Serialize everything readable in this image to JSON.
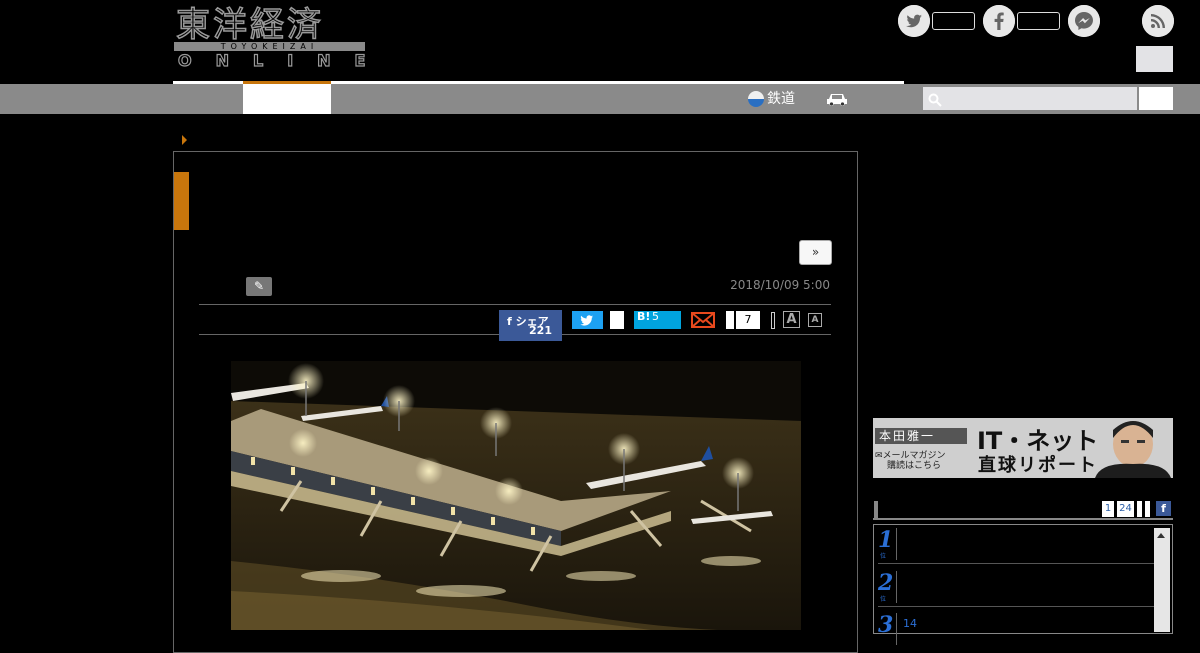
{
  "header": {
    "logo_jp": "東洋経済",
    "logo_band": "TOYOKEIZAI",
    "logo_en": "ONLINE",
    "social": [
      "twitter-icon",
      "facebook-icon",
      "messenger-icon",
      "rss-icon"
    ]
  },
  "nav": {
    "railway_label": "鉄道",
    "search_placeholder": ""
  },
  "article": {
    "next_label": "»",
    "date": "2018/10/09 5:00",
    "share": {
      "facebook_label": "シェア",
      "facebook_count": "221",
      "hatena_label": "B!",
      "hatena_count": "5",
      "comment_count": "7",
      "font_large": "A",
      "font_small": "A"
    }
  },
  "sidebar": {
    "banner": {
      "author": "本田雅一",
      "mail_line1": "メールマガジン",
      "mail_line2": "購読はこちら",
      "title1": "IT・ネット",
      "title2": "直球リポート"
    },
    "ranking": {
      "tabs": [
        "1",
        "24"
      ],
      "fb_label": "f",
      "ranks": [
        {
          "num": "1",
          "text": ""
        },
        {
          "num": "2",
          "text": ""
        },
        {
          "num": "3",
          "text": "14"
        }
      ]
    }
  },
  "colors": {
    "accent": "#c8760c",
    "nav_gray": "#8a8a8a",
    "facebook": "#3b5998",
    "twitter": "#1da1f2",
    "hatena": "#00a4de",
    "rank_blue": "#2b6fd6"
  }
}
